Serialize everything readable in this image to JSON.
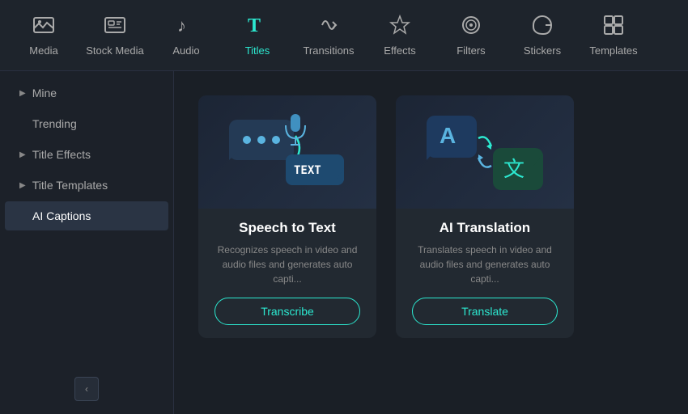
{
  "nav": {
    "items": [
      {
        "id": "media",
        "label": "Media",
        "icon": "🖼",
        "active": false
      },
      {
        "id": "stock-media",
        "label": "Stock Media",
        "icon": "📷",
        "active": false
      },
      {
        "id": "audio",
        "label": "Audio",
        "icon": "🎵",
        "active": false
      },
      {
        "id": "titles",
        "label": "Titles",
        "icon": "T",
        "active": true
      },
      {
        "id": "transitions",
        "label": "Transitions",
        "icon": "↩",
        "active": false
      },
      {
        "id": "effects",
        "label": "Effects",
        "icon": "✨",
        "active": false
      },
      {
        "id": "filters",
        "label": "Filters",
        "icon": "◎",
        "active": false
      },
      {
        "id": "stickers",
        "label": "Stickers",
        "icon": "✂",
        "active": false
      },
      {
        "id": "templates",
        "label": "Templates",
        "icon": "⊞",
        "active": false
      }
    ]
  },
  "sidebar": {
    "items": [
      {
        "id": "mine",
        "label": "Mine",
        "hasArrow": true,
        "active": false
      },
      {
        "id": "trending",
        "label": "Trending",
        "hasArrow": false,
        "active": false
      },
      {
        "id": "title-effects",
        "label": "Title Effects",
        "hasArrow": true,
        "active": false
      },
      {
        "id": "title-templates",
        "label": "Title Templates",
        "hasArrow": true,
        "active": false
      },
      {
        "id": "ai-captions",
        "label": "AI Captions",
        "hasArrow": false,
        "active": true
      }
    ],
    "collapse_icon": "‹"
  },
  "cards": [
    {
      "id": "speech-to-text",
      "title": "Speech to Text",
      "description": "Recognizes speech in video and audio files and generates auto capti...",
      "button_label": "Transcribe"
    },
    {
      "id": "ai-translation",
      "title": "AI Translation",
      "description": "Translates speech in video and audio files and generates auto capti...",
      "button_label": "Translate"
    }
  ],
  "colors": {
    "accent": "#2ce8d0",
    "active_text": "#2ce8d0",
    "sidebar_active_bg": "#2a3444"
  }
}
